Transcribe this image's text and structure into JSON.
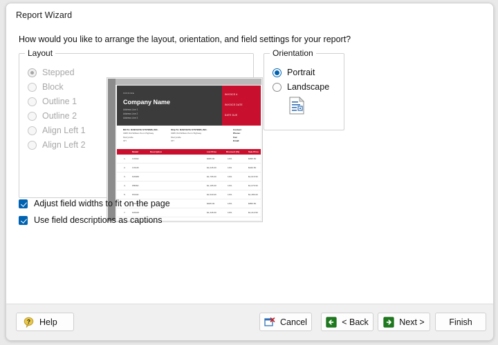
{
  "window": {
    "title": "Report Wizard"
  },
  "prompt": "How would you like to arrange the layout, orientation, and field settings for your report?",
  "layout": {
    "legend": "Layout",
    "options": [
      {
        "label": "Stepped",
        "selected": true,
        "enabled": false
      },
      {
        "label": "Block",
        "selected": false,
        "enabled": false
      },
      {
        "label": "Outline 1",
        "selected": false,
        "enabled": false
      },
      {
        "label": "Outline 2",
        "selected": false,
        "enabled": false
      },
      {
        "label": "Align Left 1",
        "selected": false,
        "enabled": false
      },
      {
        "label": "Align Left 2",
        "selected": false,
        "enabled": false
      }
    ]
  },
  "orientation": {
    "legend": "Orientation",
    "options": [
      {
        "label": "Portrait",
        "selected": true
      },
      {
        "label": "Landscape",
        "selected": false
      }
    ],
    "icon": "page-portrait-icon"
  },
  "checkboxes": [
    {
      "label": "Adjust field widths to fit on the page",
      "checked": true
    },
    {
      "label": "Use field descriptions as captions",
      "checked": true
    }
  ],
  "preview": {
    "invoice": {
      "word": "INVOICE",
      "company": "Company Name",
      "address": [
        "Address Line 1",
        "Address Line 2",
        "Address Line 3"
      ],
      "right_labels": [
        "INVOICE #",
        "INVOICE DATE",
        "DATE DUE"
      ],
      "bill_to": {
        "heading": "Bill To: RAM DATA SYSTEMS, INC.",
        "lines": [
          "3005 Old William Penn Highway",
          "Murrysville",
          "OH"
        ]
      },
      "ship_to": {
        "heading": "Ship To: RAM DATA SYSTEMS, INC.",
        "lines": [
          "3005 Old William Penn Highway",
          "Murrysville",
          "OH"
        ]
      },
      "contact": [
        "Contact:",
        "Phone:",
        "Fax:",
        "Email:"
      ],
      "columns": [
        "Model",
        "Description",
        "List Price",
        "Discount (%)",
        "Sale Price"
      ],
      "rows": [
        {
          "n": "1.",
          "model": "CX002",
          "desc": "",
          "list": "$995.00",
          "disc": "10%",
          "sale": "$895.50"
        },
        {
          "n": "2.",
          "model": "CX045",
          "desc": "",
          "list": "$1,045.00",
          "disc": "10%",
          "sale": "$940.50"
        },
        {
          "n": "3.",
          "model": "MX088",
          "desc": "",
          "list": "$1,795.00",
          "disc": "10%",
          "sale": "$1,615.50"
        },
        {
          "n": "4.",
          "model": "PB060",
          "desc": "",
          "list": "$1,195.00",
          "disc": "10%",
          "sale": "$1,075.50"
        },
        {
          "n": "5.",
          "model": "PK040",
          "desc": "",
          "list": "$1,540.00",
          "disc": "10%",
          "sale": "$1,386.00"
        },
        {
          "n": "6.",
          "model": "CX008",
          "desc": "",
          "list": "$945.00",
          "disc": "10%",
          "sale": "$850.50"
        },
        {
          "n": "7.",
          "model": "MX028",
          "desc": "",
          "list": "$1,345.00",
          "disc": "10%",
          "sale": "$1,210.50"
        }
      ]
    }
  },
  "footer": {
    "help": "Help",
    "cancel": "Cancel",
    "back": "< Back",
    "next": "Next >",
    "finish": "Finish"
  },
  "colors": {
    "accent_blue": "#0063b1",
    "invoice_red": "#c8102e",
    "invoice_dark": "#3b3b3b",
    "nav_green": "#1e7a1e",
    "help_gold": "#e8c74a"
  }
}
